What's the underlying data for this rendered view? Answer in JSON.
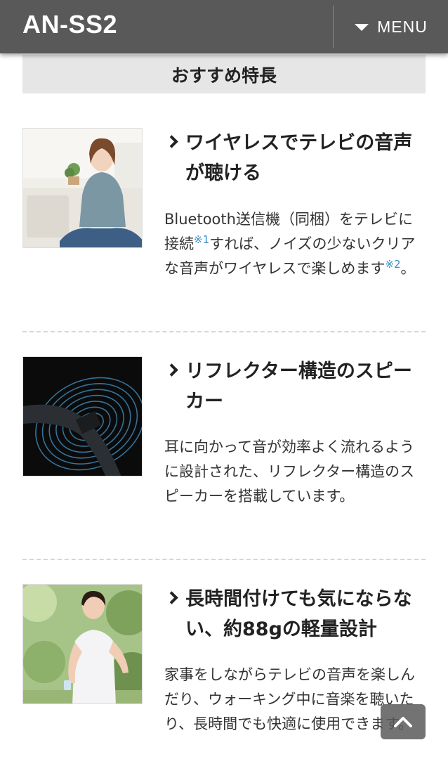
{
  "header": {
    "brand": "AN-SS2",
    "menu_label": "MENU"
  },
  "section": {
    "title": "おすすめ特長"
  },
  "features": [
    {
      "heading": "ワイヤレスでテレビの音声が聴ける",
      "desc_parts": [
        "Bluetooth送信機（同梱）をテレビに接続",
        "※1",
        "すれば、ノイズの少ないクリアな音声がワイヤレスで楽しめます",
        "※2",
        "。"
      ]
    },
    {
      "heading": "リフレクター構造のスピーカー",
      "desc": "耳に向かって音が効率よく流れるように設計された、リフレクター構造のスピーカーを搭載しています。"
    },
    {
      "heading": "長時間付けても気にならない、約88gの軽量設計",
      "desc": "家事をしながらテレビの音声を楽しんだり、ウォーキング中に音楽を聴いたり、長時間でも快適に使用できます。"
    }
  ],
  "colors": {
    "header_bg": "#595959",
    "section_bg": "#e6e6e6",
    "note": "#2f8fc8"
  },
  "icons": {
    "menu": "triangle-down-icon",
    "feature": "chevron-right-icon",
    "back_to_top": "chevron-up-icon"
  }
}
